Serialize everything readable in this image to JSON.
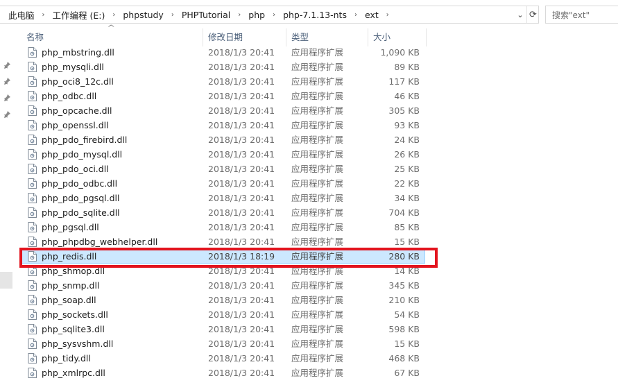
{
  "address": {
    "crumbs": [
      "此电脑",
      "工作编程 (E:)",
      "phpstudy",
      "PHPTutorial",
      "php",
      "php-7.1.13-nts",
      "ext"
    ]
  },
  "search": {
    "placeholder": "搜索\"ext\""
  },
  "columns": {
    "name": "名称",
    "date": "修改日期",
    "type": "类型",
    "size": "大小"
  },
  "files": [
    {
      "name": "php_mbstring.dll",
      "date": "2018/1/3 20:41",
      "type": "应用程序扩展",
      "size": "1,090 KB"
    },
    {
      "name": "php_mysqli.dll",
      "date": "2018/1/3 20:41",
      "type": "应用程序扩展",
      "size": "89 KB"
    },
    {
      "name": "php_oci8_12c.dll",
      "date": "2018/1/3 20:41",
      "type": "应用程序扩展",
      "size": "117 KB"
    },
    {
      "name": "php_odbc.dll",
      "date": "2018/1/3 20:41",
      "type": "应用程序扩展",
      "size": "46 KB"
    },
    {
      "name": "php_opcache.dll",
      "date": "2018/1/3 20:41",
      "type": "应用程序扩展",
      "size": "305 KB"
    },
    {
      "name": "php_openssl.dll",
      "date": "2018/1/3 20:41",
      "type": "应用程序扩展",
      "size": "93 KB"
    },
    {
      "name": "php_pdo_firebird.dll",
      "date": "2018/1/3 20:41",
      "type": "应用程序扩展",
      "size": "24 KB"
    },
    {
      "name": "php_pdo_mysql.dll",
      "date": "2018/1/3 20:41",
      "type": "应用程序扩展",
      "size": "26 KB"
    },
    {
      "name": "php_pdo_oci.dll",
      "date": "2018/1/3 20:41",
      "type": "应用程序扩展",
      "size": "25 KB"
    },
    {
      "name": "php_pdo_odbc.dll",
      "date": "2018/1/3 20:41",
      "type": "应用程序扩展",
      "size": "22 KB"
    },
    {
      "name": "php_pdo_pgsql.dll",
      "date": "2018/1/3 20:41",
      "type": "应用程序扩展",
      "size": "34 KB"
    },
    {
      "name": "php_pdo_sqlite.dll",
      "date": "2018/1/3 20:41",
      "type": "应用程序扩展",
      "size": "704 KB"
    },
    {
      "name": "php_pgsql.dll",
      "date": "2018/1/3 20:41",
      "type": "应用程序扩展",
      "size": "85 KB"
    },
    {
      "name": "php_phpdbg_webhelper.dll",
      "date": "2018/1/3 20:41",
      "type": "应用程序扩展",
      "size": "15 KB"
    },
    {
      "name": "php_redis.dll",
      "date": "2018/1/3 18:19",
      "type": "应用程序扩展",
      "size": "280 KB",
      "selected": true
    },
    {
      "name": "php_shmop.dll",
      "date": "2018/1/3 20:41",
      "type": "应用程序扩展",
      "size": "14 KB"
    },
    {
      "name": "php_snmp.dll",
      "date": "2018/1/3 20:41",
      "type": "应用程序扩展",
      "size": "345 KB"
    },
    {
      "name": "php_soap.dll",
      "date": "2018/1/3 20:41",
      "type": "应用程序扩展",
      "size": "210 KB"
    },
    {
      "name": "php_sockets.dll",
      "date": "2018/1/3 20:41",
      "type": "应用程序扩展",
      "size": "54 KB"
    },
    {
      "name": "php_sqlite3.dll",
      "date": "2018/1/3 20:41",
      "type": "应用程序扩展",
      "size": "598 KB"
    },
    {
      "name": "php_sysvshm.dll",
      "date": "2018/1/3 20:41",
      "type": "应用程序扩展",
      "size": "15 KB"
    },
    {
      "name": "php_tidy.dll",
      "date": "2018/1/3 20:41",
      "type": "应用程序扩展",
      "size": "468 KB"
    },
    {
      "name": "php_xmlrpc.dll",
      "date": "2018/1/3 20:41",
      "type": "应用程序扩展",
      "size": "67 KB"
    }
  ],
  "colors": {
    "selection": "#cce8ff",
    "selection_border": "#99d1ff",
    "annotation": "#e3141e",
    "header_text": "#4c607a"
  },
  "icons": {
    "file": "dll-file-icon",
    "pin": "pin-icon",
    "refresh": "refresh-icon",
    "dropdown": "chevron-down-icon"
  }
}
